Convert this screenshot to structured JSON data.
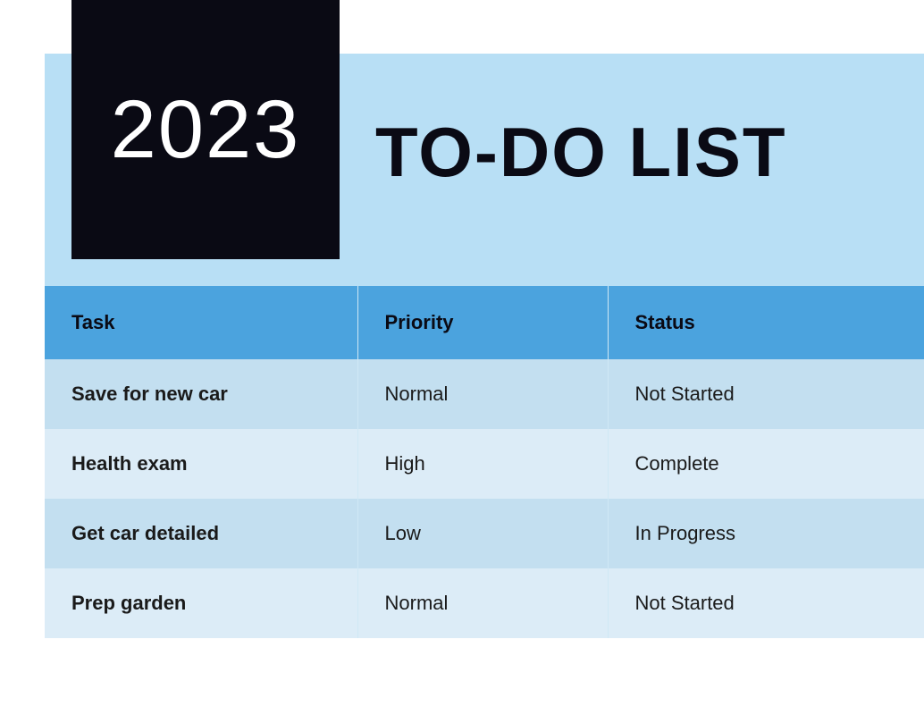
{
  "header": {
    "year": "2023",
    "title": "TO-DO LIST"
  },
  "table": {
    "columns": {
      "task": "Task",
      "priority": "Priority",
      "status": "Status"
    },
    "rows": [
      {
        "task": "Save for new car",
        "priority": "Normal",
        "status": "Not Started"
      },
      {
        "task": "Health exam",
        "priority": "High",
        "status": "Complete"
      },
      {
        "task": "Get car detailed",
        "priority": "Low",
        "status": "In Progress"
      },
      {
        "task": "Prep garden",
        "priority": "Normal",
        "status": "Not Started"
      }
    ]
  }
}
